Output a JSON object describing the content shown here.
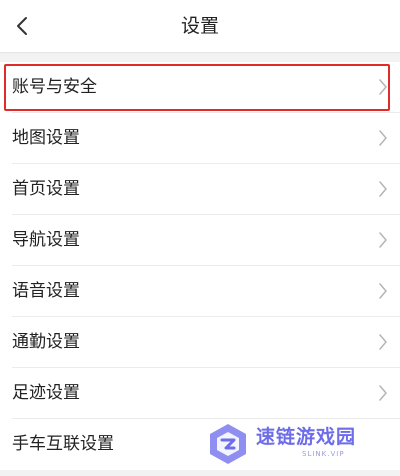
{
  "header": {
    "title": "设置",
    "back_icon": "chevron-left-icon"
  },
  "settings": {
    "items": [
      {
        "label": "账号与安全",
        "icon": "chevron-right-icon",
        "highlighted": true
      },
      {
        "label": "地图设置",
        "icon": "chevron-right-icon"
      },
      {
        "label": "首页设置",
        "icon": "chevron-right-icon"
      },
      {
        "label": "导航设置",
        "icon": "chevron-right-icon"
      },
      {
        "label": "语音设置",
        "icon": "chevron-right-icon"
      },
      {
        "label": "通勤设置",
        "icon": "chevron-right-icon"
      },
      {
        "label": "足迹设置",
        "icon": "chevron-right-icon"
      },
      {
        "label": "手车互联设置",
        "icon": "chevron-right-icon"
      }
    ]
  },
  "watermark": {
    "text": "速链游戏园",
    "subtext": "SLINK.VIP"
  },
  "colors": {
    "highlight_border": "#e02b2b",
    "watermark_accent": "#6d6dea"
  }
}
